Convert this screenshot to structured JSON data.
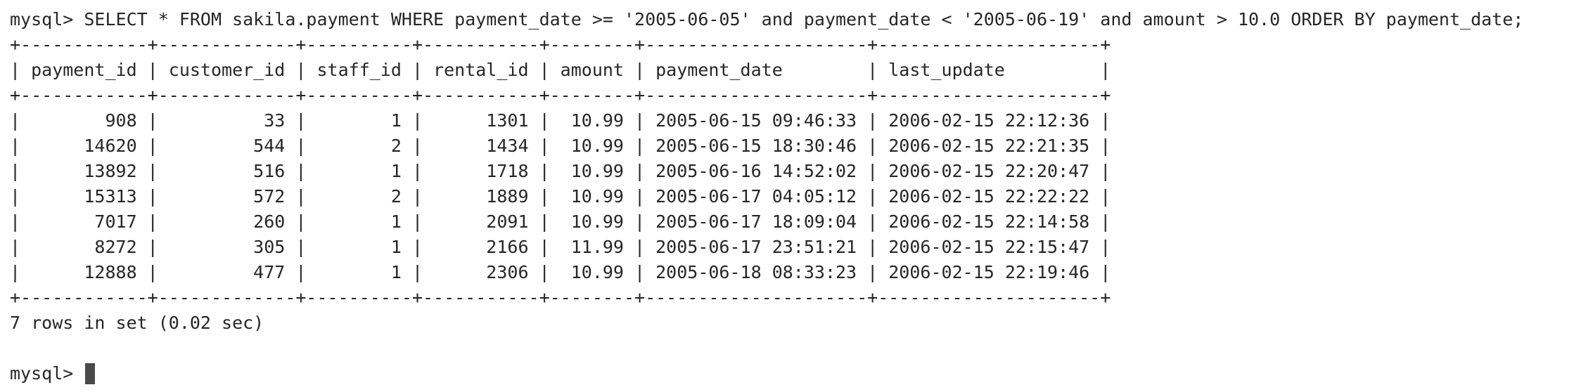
{
  "terminal": {
    "prompt": "mysql> ",
    "query": "SELECT * FROM sakila.payment WHERE payment_date >= '2005-06-05' and payment_date < '2005-06-19' and amount > 10.0 ORDER BY payment_date;",
    "table": {
      "columns": [
        "payment_id",
        "customer_id",
        "staff_id",
        "rental_id",
        "amount",
        "payment_date",
        "last_update"
      ],
      "align": [
        "right",
        "right",
        "right",
        "right",
        "right",
        "left",
        "left"
      ],
      "rows": [
        [
          "908",
          "33",
          "1",
          "1301",
          "10.99",
          "2005-06-15 09:46:33",
          "2006-02-15 22:12:36"
        ],
        [
          "14620",
          "544",
          "2",
          "1434",
          "10.99",
          "2005-06-15 18:30:46",
          "2006-02-15 22:21:35"
        ],
        [
          "13892",
          "516",
          "1",
          "1718",
          "10.99",
          "2005-06-16 14:52:02",
          "2006-02-15 22:20:47"
        ],
        [
          "15313",
          "572",
          "2",
          "1889",
          "10.99",
          "2005-06-17 04:05:12",
          "2006-02-15 22:22:22"
        ],
        [
          "7017",
          "260",
          "1",
          "2091",
          "10.99",
          "2005-06-17 18:09:04",
          "2006-02-15 22:14:58"
        ],
        [
          "8272",
          "305",
          "1",
          "2166",
          "11.99",
          "2005-06-17 23:51:21",
          "2006-02-15 22:15:47"
        ],
        [
          "12888",
          "477",
          "1",
          "2306",
          "10.99",
          "2005-06-18 08:33:23",
          "2006-02-15 22:19:46"
        ]
      ]
    },
    "summary": "7 rows in set (0.02 sec)",
    "final_prompt": "mysql> "
  }
}
